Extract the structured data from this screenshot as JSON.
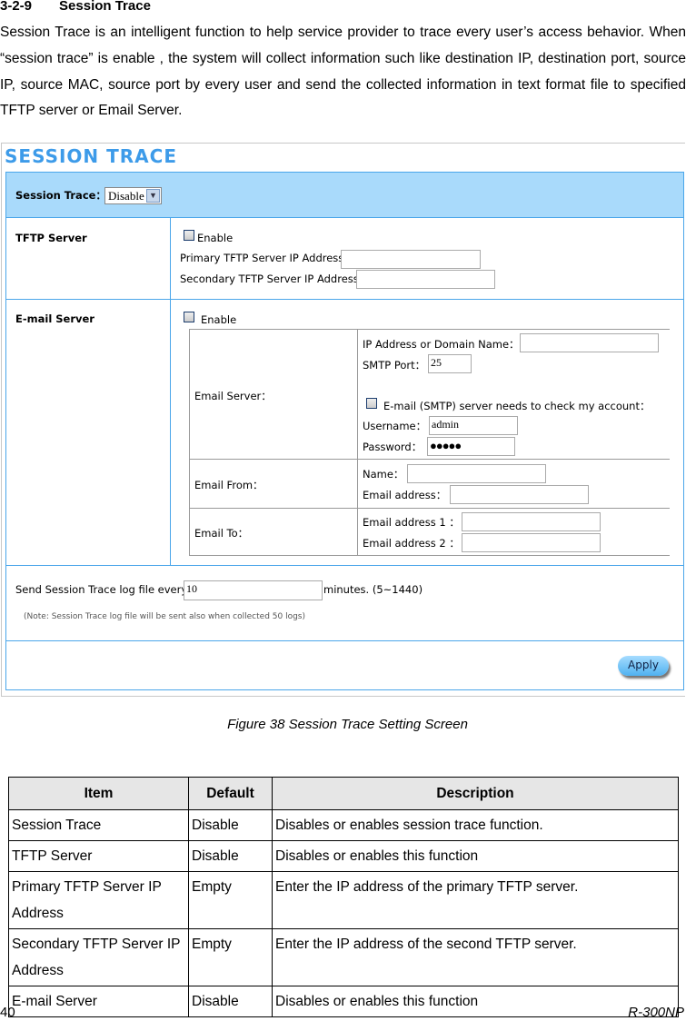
{
  "heading": {
    "number": "3-2-9",
    "title": "Session Trace"
  },
  "intro": "Session Trace is an intelligent function to help service provider to trace every user’s access behavior. When “session trace” is enable , the system will collect information such like destination IP, destination port, source IP, source MAC, source port by every user and send the collected information in text format file to specified TFTP server or Email Server.",
  "screen": {
    "title": "SESSION TRACE",
    "session_trace_label": "Session Trace：",
    "session_trace_value": "Disable",
    "tftp": {
      "label": "TFTP Server",
      "enable": "Enable",
      "primary": "Primary TFTP Server IP Address",
      "secondary": "Secondary TFTP Server IP Address",
      "primary_value": "",
      "secondary_value": ""
    },
    "email": {
      "label": "E-mail Server",
      "enable": "Enable",
      "server_label": "Email Server：",
      "ip_label": "IP Address or Domain Name：",
      "ip_value": "",
      "port_label": "SMTP Port：",
      "port_value": "25",
      "check_label": "E-mail (SMTP) server needs to check my account：",
      "user_label": "Username：",
      "user_value": "admin",
      "pass_label": "Password：",
      "pass_value": "●●●●●",
      "from_label": "Email From：",
      "name_label": "Name：",
      "from_addr_label": "Email address：",
      "to_label": "Email To：",
      "to1_label": "Email address 1 ：",
      "to2_label": "Email address 2 ："
    },
    "send_label": "Send Session Trace log file every",
    "send_value": "10",
    "send_unit": "minutes. (5~1440)",
    "note": "(Note: Session Trace log file will be sent also when collected 50 logs)",
    "apply": "Apply"
  },
  "caption": "Figure 38 Session Trace Setting Screen",
  "table": {
    "headers": [
      "Item",
      "Default",
      "Description"
    ],
    "rows": [
      [
        "Session Trace",
        "Disable",
        "Disables or enables session trace function."
      ],
      [
        "TFTP Server",
        "Disable",
        "Disables or enables this function"
      ],
      [
        "Primary TFTP Server IP Address",
        "Empty",
        "Enter the IP address of the primary TFTP server."
      ],
      [
        "Secondary TFTP Server IP Address",
        "Empty",
        "Enter the IP address of the second TFTP server."
      ],
      [
        "E-mail Server",
        "Disable",
        "Disables or enables this function"
      ]
    ]
  },
  "footer": {
    "page": "40",
    "model": "R-300NP"
  }
}
